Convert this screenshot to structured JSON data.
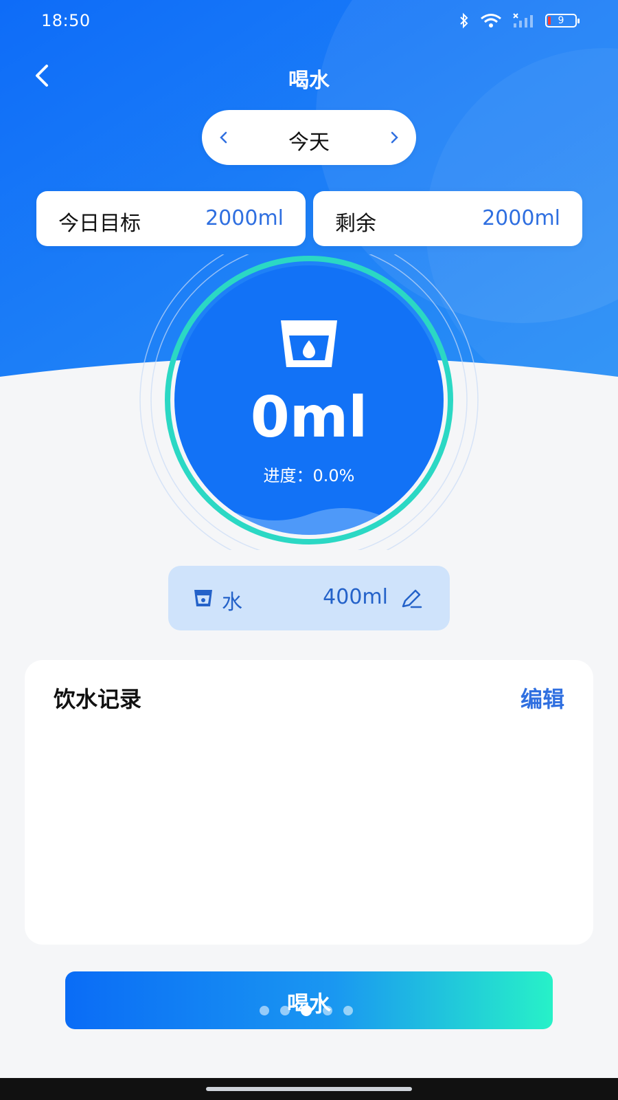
{
  "status_bar": {
    "time": "18:50",
    "battery": "9"
  },
  "header": {
    "title": "喝水"
  },
  "date_selector": {
    "label": "今天"
  },
  "stats": {
    "goal": {
      "label": "今日目标",
      "value": "2000ml"
    },
    "remaining": {
      "label": "剩余",
      "value": "2000ml"
    }
  },
  "gauge": {
    "amount": "0ml",
    "progress_text": "进度：0.0%",
    "progress_fraction": 0.0
  },
  "cup": {
    "name": "水",
    "amount": "400ml"
  },
  "records": {
    "title": "饮水记录",
    "edit_label": "编辑",
    "items": []
  },
  "drink_button": {
    "label": "喝水"
  },
  "pager": {
    "count": 5,
    "active_index": 2
  },
  "colors": {
    "primary": "#1474f5",
    "accent_teal": "#27e6c2",
    "text_blue": "#2f6fe0",
    "chip_bg": "#cfe3fb"
  }
}
